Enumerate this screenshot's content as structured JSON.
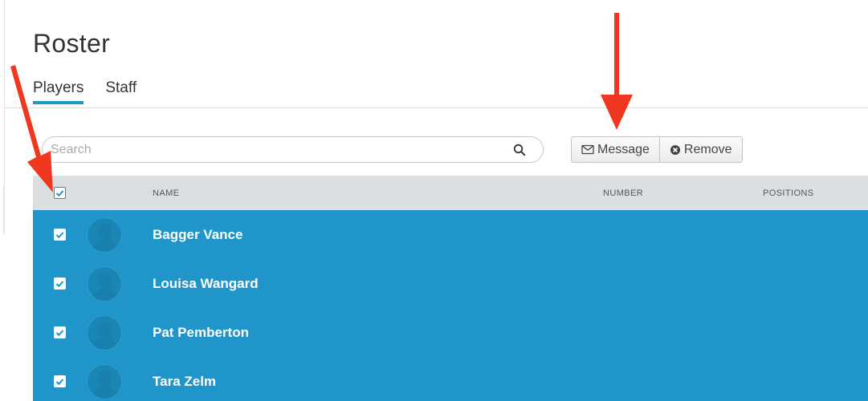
{
  "page": {
    "title": "Roster"
  },
  "tabs": [
    {
      "label": "Players",
      "active": true
    },
    {
      "label": "Staff",
      "active": false
    }
  ],
  "search": {
    "placeholder": "Search",
    "value": "",
    "icon": "search-icon"
  },
  "actions": {
    "message": {
      "label": "Message",
      "icon": "envelope-icon"
    },
    "remove": {
      "label": "Remove",
      "icon": "remove-circle-icon"
    }
  },
  "table": {
    "columns": {
      "name": "NAME",
      "number": "NUMBER",
      "positions": "POSITIONS"
    },
    "select_all_checked": true,
    "rows": [
      {
        "name": "Bagger Vance",
        "number": "",
        "positions": "",
        "checked": true
      },
      {
        "name": "Louisa Wangard",
        "number": "",
        "positions": "",
        "checked": true
      },
      {
        "name": "Pat Pemberton",
        "number": "",
        "positions": "",
        "checked": true
      },
      {
        "name": "Tara Zelm",
        "number": "",
        "positions": "",
        "checked": true
      }
    ]
  },
  "colors": {
    "accent": "#1f95c9",
    "header_bg": "#dcdfe1",
    "annotation_arrow": "#f0371f"
  }
}
